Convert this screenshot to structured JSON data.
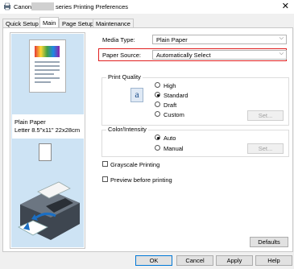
{
  "window": {
    "title_prefix": "Canon",
    "title_suffix": "series Printing Preferences",
    "close_glyph": "✕",
    "app_icon": "printer-icon"
  },
  "tabs": [
    {
      "label": "Quick Setup"
    },
    {
      "label": "Main",
      "active": true
    },
    {
      "label": "Page Setup"
    },
    {
      "label": "Maintenance"
    }
  ],
  "preview": {
    "paper_name": "Plain Paper",
    "paper_size": "Letter 8.5\"x11\" 22x28cm"
  },
  "media_type": {
    "label": "Media Type:",
    "value": "Plain Paper"
  },
  "paper_source": {
    "label": "Paper Source:",
    "value": "Automatically Select"
  },
  "print_quality": {
    "title": "Print Quality",
    "options": [
      "High",
      "Standard",
      "Draft",
      "Custom"
    ],
    "selected": "Standard",
    "set_label": "Set..."
  },
  "color_intensity": {
    "title": "Color/Intensity",
    "options": [
      "Auto",
      "Manual"
    ],
    "selected": "Auto",
    "set_label": "Set..."
  },
  "grayscale": {
    "label": "Grayscale Printing",
    "checked": false
  },
  "preview_before": {
    "label": "Preview before printing",
    "checked": false
  },
  "defaults_label": "Defaults",
  "footer": {
    "ok": "OK",
    "cancel": "Cancel",
    "apply": "Apply",
    "help": "Help"
  },
  "colors": {
    "highlight": "#e02020",
    "preview_bg": "#cde3f4",
    "focus_border": "#0078d7"
  }
}
